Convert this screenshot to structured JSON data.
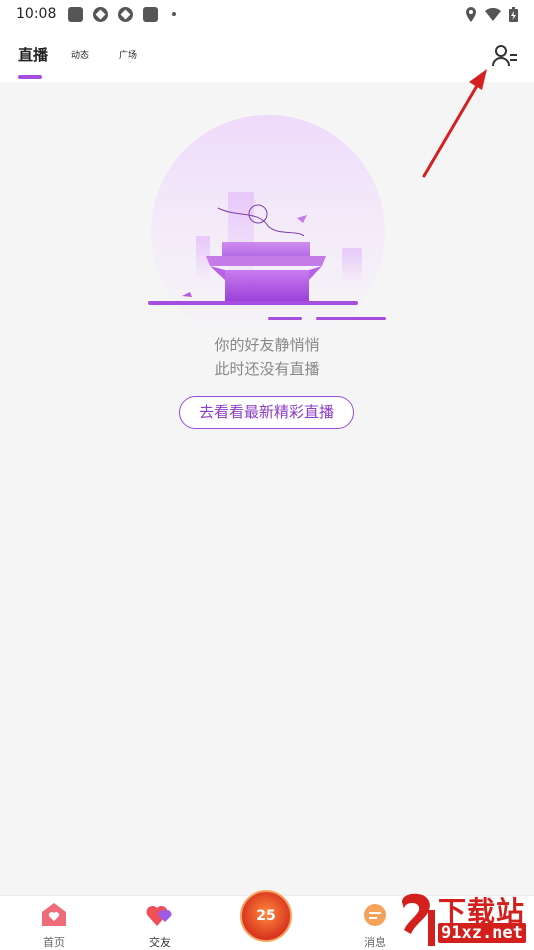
{
  "status_bar": {
    "time": "10:08"
  },
  "top_tabs": [
    {
      "label": "直播"
    },
    {
      "label": "动态"
    },
    {
      "label": "广场"
    }
  ],
  "empty_state": {
    "line1": "你的好友静悄悄",
    "line2": "此时还没有直播",
    "button": "去看看最新精彩直播"
  },
  "bottom_nav": {
    "home": "首页",
    "friends": "交友",
    "center_badge": "25",
    "messages": "消息"
  },
  "watermark": {
    "text": "下载站",
    "url": "91xz.net"
  },
  "colors": {
    "accent": "#a54ee0",
    "arrow": "#d32020",
    "watermark": "#d3201c"
  }
}
